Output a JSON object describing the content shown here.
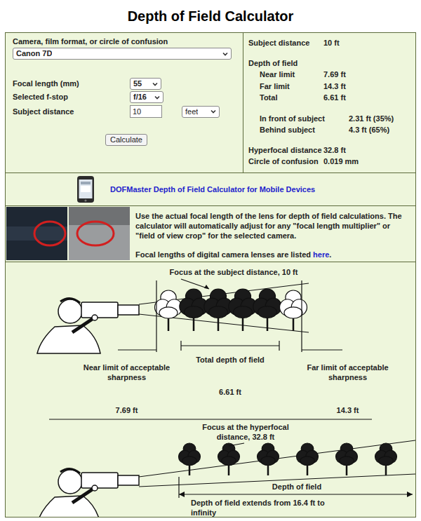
{
  "title": "Depth of Field Calculator",
  "form": {
    "camera": {
      "label": "Camera, film format, or circle of confusion",
      "value": "Canon 7D"
    },
    "focal_length": {
      "label": "Focal length (mm)",
      "value": "55"
    },
    "fstop": {
      "label": "Selected f-stop",
      "value": "f/16"
    },
    "subject_distance": {
      "label": "Subject distance",
      "value": "10",
      "unit": "feet"
    },
    "button": "Calculate"
  },
  "results": {
    "subject_distance": {
      "label": "Subject distance",
      "value": "10 ft"
    },
    "dof_heading": "Depth of field",
    "dof": [
      {
        "label": "Near limit",
        "value": "7.69 ft"
      },
      {
        "label": "Far limit",
        "value": "14.3 ft"
      },
      {
        "label": "Total",
        "value": "6.61 ft"
      }
    ],
    "split": [
      {
        "label": "In front of subject",
        "value": "2.31 ft (35%)"
      },
      {
        "label": "Behind subject",
        "value": "4.3 ft (65%)"
      }
    ],
    "extra": [
      {
        "label": "Hyperfocal distance",
        "value": "32.8 ft"
      },
      {
        "label": "Circle of confusion",
        "value": "0.019 mm"
      }
    ]
  },
  "mobile": {
    "link": "DOFMaster Depth of Field Calculator for Mobile Devices"
  },
  "lens_note": {
    "text": "Use the actual focal length of the lens for depth of field calculations. The calculator will automatically adjust for any \"focal length multiplier\" or \"field of view crop\" for the selected camera.",
    "focal_text": "Focal lengths of digital camera lenses are listed ",
    "focal_link": "here",
    "focal_end": "."
  },
  "diagram": {
    "subject": {
      "caption": "Focus at the subject distance, 10 ft",
      "total_label": "Total depth of field",
      "total_value": "6.61 ft",
      "near_label": "Near limit of acceptable sharpness",
      "near_value": "7.69 ft",
      "far_label": "Far limit of acceptable sharpness",
      "far_value": "14.3 ft"
    },
    "hyperfocal": {
      "caption": "Focus at the hyperfocal distance, 32.8 ft",
      "dof_label": "Depth of field",
      "note": "Depth of field extends from 16.4 ft to infinity"
    }
  }
}
